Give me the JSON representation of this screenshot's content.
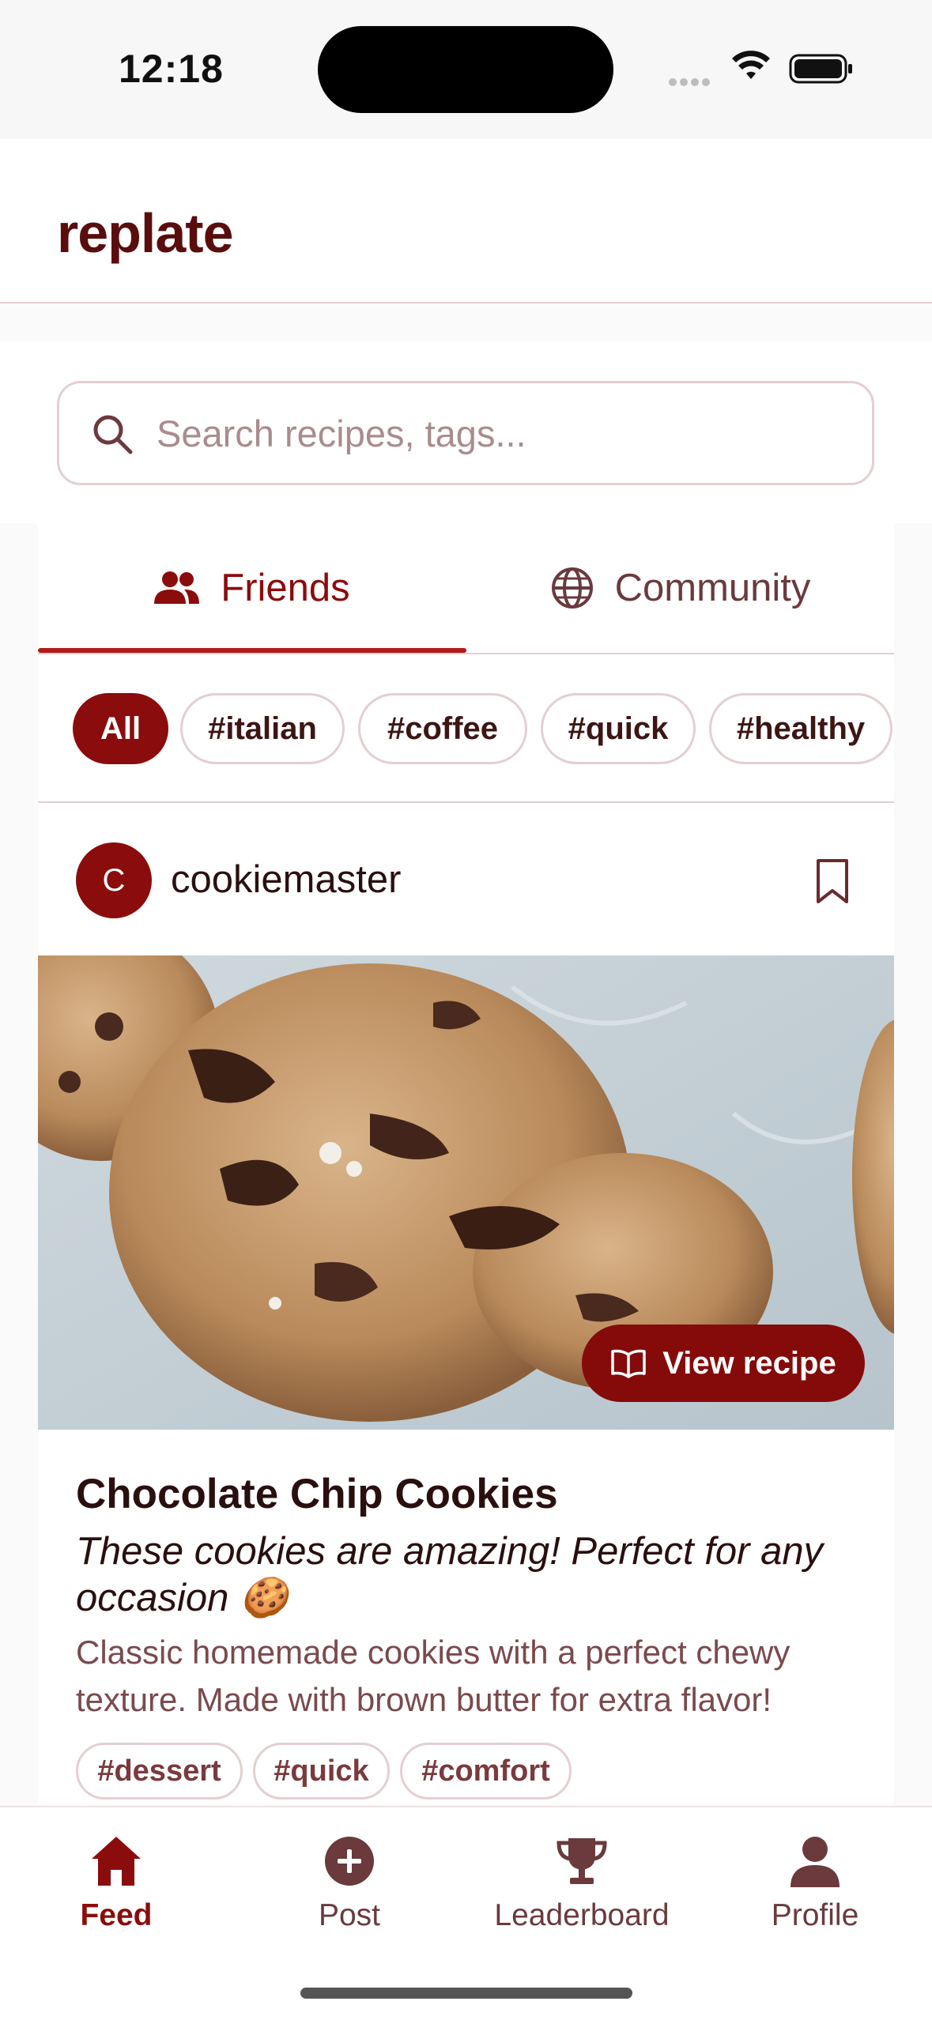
{
  "status_bar": {
    "time": "12:18"
  },
  "app": {
    "title": "replate"
  },
  "search": {
    "placeholder": "Search recipes, tags..."
  },
  "tabs": [
    {
      "label": "Friends",
      "icon": "users-icon",
      "active": true
    },
    {
      "label": "Community",
      "icon": "globe-icon",
      "active": false
    }
  ],
  "filters": [
    "All",
    "#italian",
    "#coffee",
    "#quick",
    "#healthy"
  ],
  "post": {
    "avatar_letter": "C",
    "username": "cookiemaster",
    "image_alt": "chocolate chip cookies",
    "view_recipe_label": "View recipe",
    "title": "Chocolate Chip Cookies",
    "caption": "These cookies are amazing! Perfect for any occasion 🍪",
    "description": "Classic homemade cookies with a perfect chewy texture. Made with brown butter for extra flavor!",
    "tags": [
      "#dessert",
      "#quick",
      "#comfort"
    ]
  },
  "nav": [
    {
      "label": "Feed",
      "icon": "home-icon",
      "active": true
    },
    {
      "label": "Post",
      "icon": "plus-circle-icon",
      "active": false
    },
    {
      "label": "Leaderboard",
      "icon": "trophy-icon",
      "active": false
    },
    {
      "label": "Profile",
      "icon": "person-icon",
      "active": false
    }
  ],
  "colors": {
    "primary": "#8b0c0c",
    "border": "#e3cfd1",
    "muted": "#7a4a4d"
  }
}
